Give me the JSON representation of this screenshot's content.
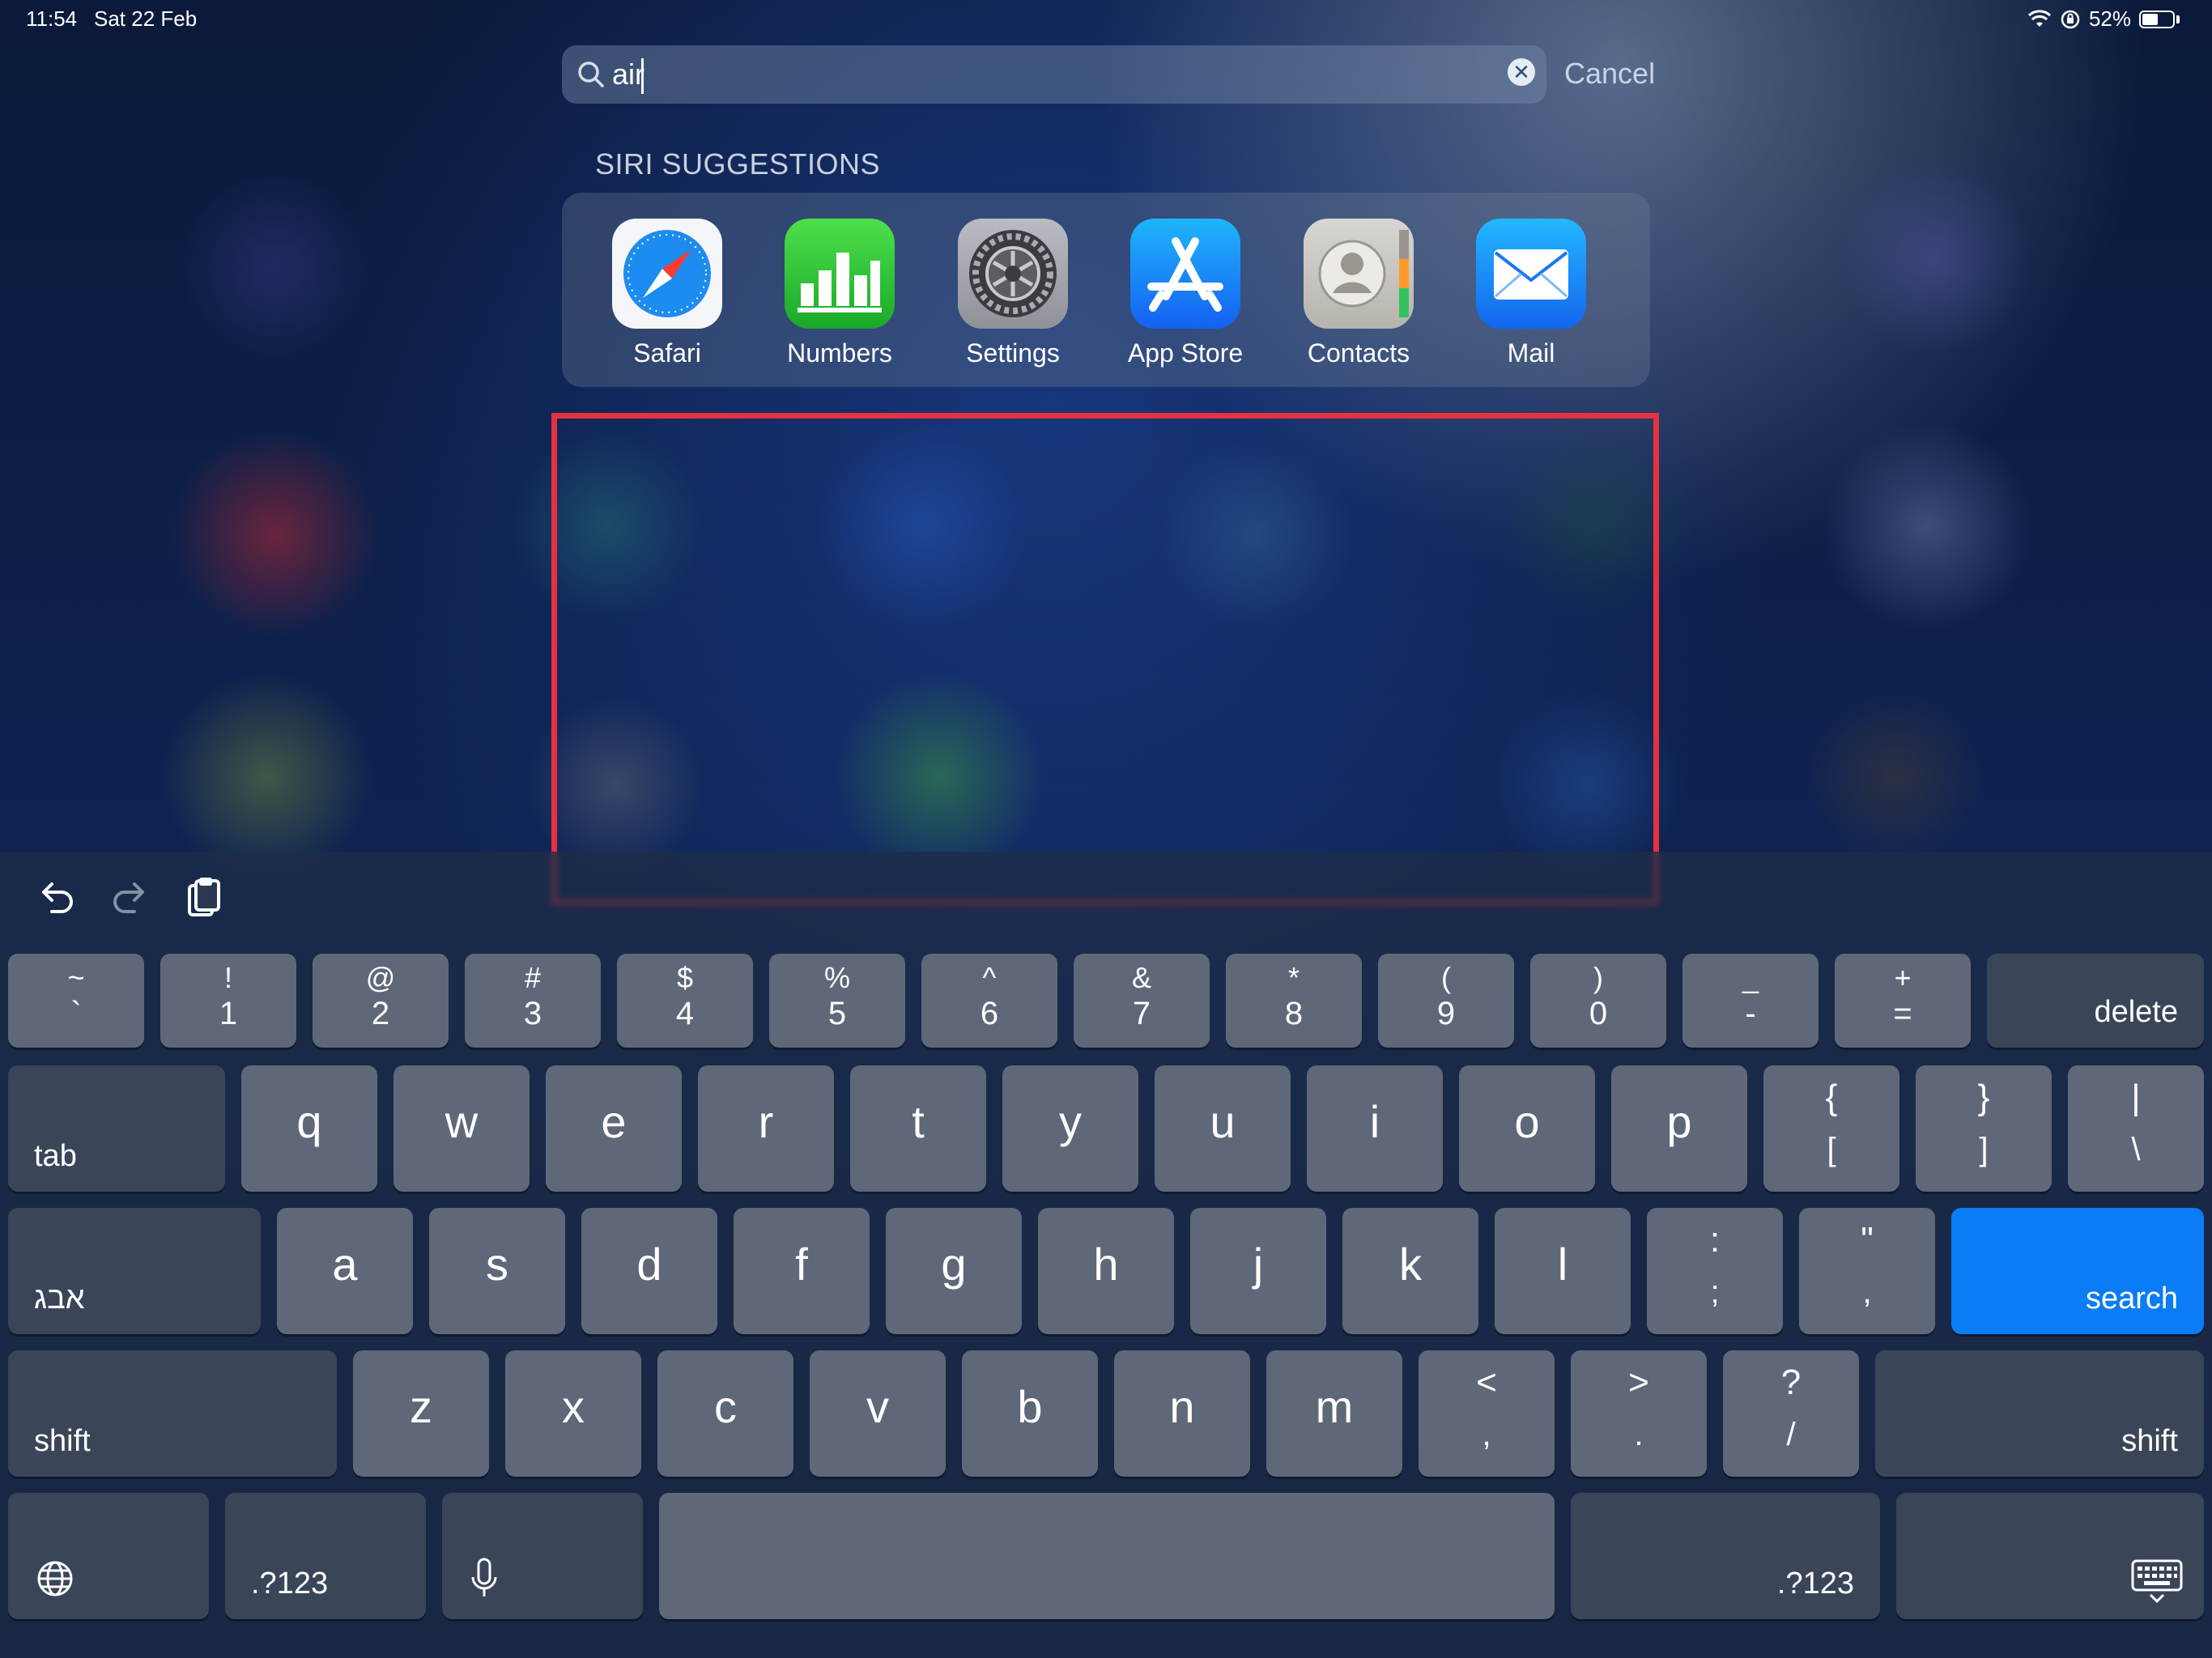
{
  "status_bar": {
    "time": "11:54",
    "date": "Sat 22 Feb",
    "battery": "52%",
    "battery_level": 0.52
  },
  "search": {
    "value": "air",
    "cancel_label": "Cancel"
  },
  "siri": {
    "heading": "SIRI SUGGESTIONS",
    "apps": [
      {
        "label": "Safari",
        "icon": "safari-icon"
      },
      {
        "label": "Numbers",
        "icon": "numbers-icon"
      },
      {
        "label": "Settings",
        "icon": "settings-icon"
      },
      {
        "label": "App Store",
        "icon": "app-store-icon"
      },
      {
        "label": "Contacts",
        "icon": "contacts-icon"
      },
      {
        "label": "Mail",
        "icon": "mail-icon"
      }
    ]
  },
  "colors": {
    "highlight": "#e5323f",
    "search_key": "#0a7cf6"
  },
  "keyboard": {
    "toolbar": [
      "undo-icon",
      "redo-icon",
      "paste-icon"
    ],
    "number_row": [
      {
        "top": "~",
        "bottom": "`"
      },
      {
        "top": "!",
        "bottom": "1"
      },
      {
        "top": "@",
        "bottom": "2"
      },
      {
        "top": "#",
        "bottom": "3"
      },
      {
        "top": "$",
        "bottom": "4"
      },
      {
        "top": "%",
        "bottom": "5"
      },
      {
        "top": "^",
        "bottom": "6"
      },
      {
        "top": "&",
        "bottom": "7"
      },
      {
        "top": "*",
        "bottom": "8"
      },
      {
        "top": "(",
        "bottom": "9"
      },
      {
        "top": ")",
        "bottom": "0"
      },
      {
        "top": "_",
        "bottom": "-"
      },
      {
        "top": "+",
        "bottom": "="
      }
    ],
    "delete_label": "delete",
    "tab_label": "tab",
    "qwerty_row": [
      "q",
      "w",
      "e",
      "r",
      "t",
      "y",
      "u",
      "i",
      "o",
      "p"
    ],
    "bracket_keys": [
      {
        "top": "{",
        "bottom": "["
      },
      {
        "top": "}",
        "bottom": "]"
      },
      {
        "top": "|",
        "bottom": "\\"
      }
    ],
    "language_label": "אבג",
    "home_row": [
      "a",
      "s",
      "d",
      "f",
      "g",
      "h",
      "j",
      "k",
      "l"
    ],
    "home_punct": [
      {
        "top": ":",
        "bottom": ";"
      },
      {
        "top": "\"",
        "bottom": ","
      }
    ],
    "search_label": "search",
    "shift_label": "shift",
    "bottom_row": [
      "z",
      "x",
      "c",
      "v",
      "b",
      "n",
      "m"
    ],
    "bottom_punct": [
      {
        "top": "<",
        "bottom": ","
      },
      {
        "top": ">",
        "bottom": "."
      },
      {
        "top": "?",
        "bottom": "/"
      }
    ],
    "numbers_label": ".?123"
  }
}
